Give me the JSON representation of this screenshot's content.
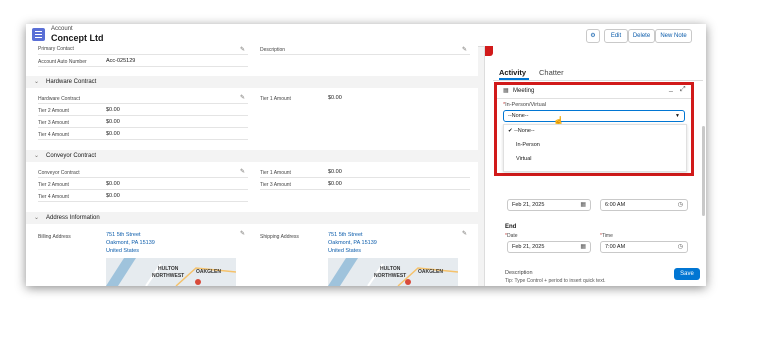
{
  "header": {
    "object_type": "Account",
    "record_name": "Concept Ltd",
    "actions": [
      "Edit",
      "Delete",
      "New Note"
    ]
  },
  "details": {
    "top_fields": [
      {
        "label": "Primary Contact",
        "value": ""
      },
      {
        "label": "Description",
        "value": ""
      },
      {
        "label": "Account Auto Number",
        "value": "Acc-025129"
      }
    ],
    "hardware": {
      "title": "Hardware Contract",
      "fields": [
        {
          "label": "Hardware Contract",
          "value": ""
        },
        {
          "label": "Tier 1 Amount",
          "value": "$0.00"
        },
        {
          "label": "Tier 2 Amount",
          "value": "$0.00"
        },
        {
          "label": "Tier 3 Amount",
          "value": "$0.00"
        },
        {
          "label": "Tier 4 Amount",
          "value": "$0.00"
        }
      ]
    },
    "conveyor": {
      "title": "Conveyor Contract",
      "fields": [
        {
          "label": "Conveyor Contract",
          "value": ""
        },
        {
          "label": "Tier 1 Amount",
          "value": "$0.00"
        },
        {
          "label": "Tier 2 Amount",
          "value": "$0.00"
        },
        {
          "label": "Tier 3 Amount",
          "value": "$0.00"
        },
        {
          "label": "Tier 4 Amount",
          "value": "$0.00"
        }
      ]
    },
    "address": {
      "title": "Address Information",
      "billing_label": "Billing Address",
      "shipping_label": "Shipping Address",
      "street": "751 5th Street",
      "city": "Oakmont, PA 15139",
      "country": "United States",
      "map_labels": [
        "HULTON",
        "NORTHWEST",
        "OAKGLEN"
      ]
    }
  },
  "activity": {
    "tabs": [
      "Activity",
      "Chatter"
    ],
    "panel_title": "Meeting",
    "field_label": "In-Person/Virtual",
    "select_value": "--None--",
    "options": [
      "--None--",
      "In-Person",
      "Virtual"
    ],
    "start": {
      "date": "Feb 21, 2025",
      "time": "6:00 AM"
    },
    "end": {
      "section": "End",
      "date_label": "Date",
      "time_label": "Time",
      "date": "Feb 21, 2025",
      "time": "7:00 AM"
    },
    "description_label": "Description",
    "description_tip": "Tip: Type Control + period to insert quick text.",
    "save_label": "Save"
  },
  "colors": {
    "brand": "#0176d3",
    "highlight": "#d11a1a",
    "link": "#0b5cab"
  }
}
